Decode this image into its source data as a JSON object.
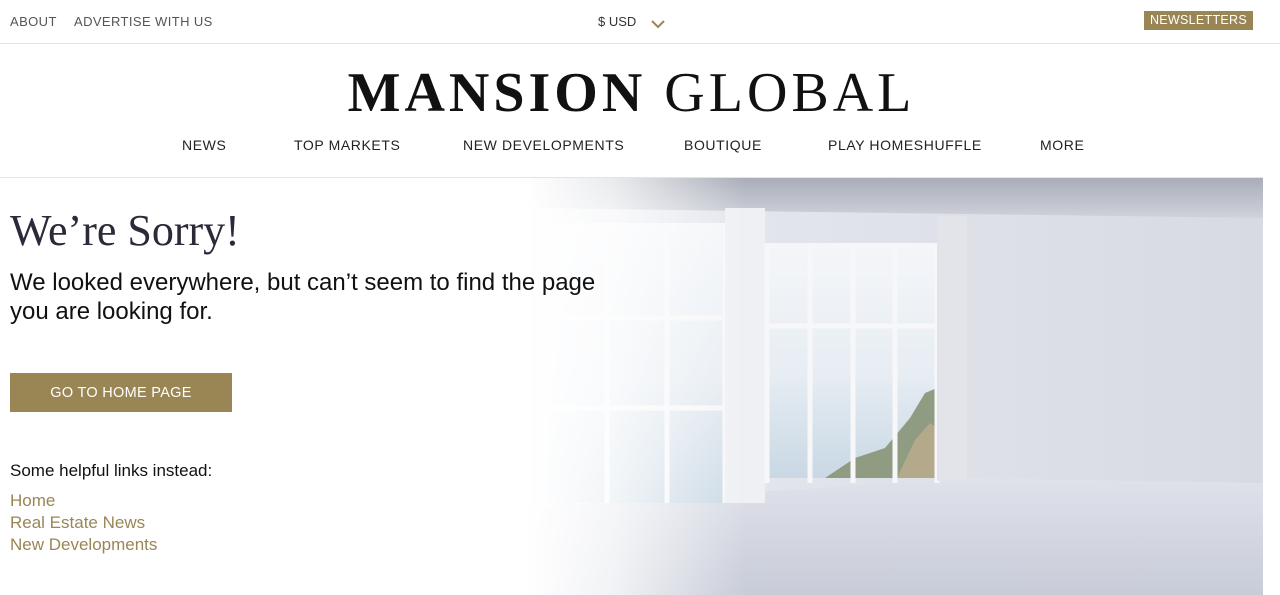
{
  "topbar": {
    "about": "ABOUT",
    "advertise": "ADVERTISE WITH US",
    "currency": "$ USD",
    "newsletters": "NEWSLETTERS"
  },
  "header": {
    "logo_bold": "MANSION",
    "logo_light": "GLOBAL"
  },
  "nav": {
    "items": [
      "NEWS",
      "TOP MARKETS",
      "NEW DEVELOPMENTS",
      "BOUTIQUE",
      "PLAY HOMESHUFFLE",
      "MORE"
    ]
  },
  "error": {
    "title": "We’re Sorry!",
    "message": "We looked everywhere, but can’t seem to find the page you are looking for.",
    "home_button": "GO TO HOME PAGE",
    "helpful_label": "Some helpful links instead:",
    "links": [
      "Home",
      "Real Estate News",
      "New Developments"
    ]
  },
  "colors": {
    "accent": "#9a8654",
    "title": "#2a2a38"
  },
  "icons": {
    "currency_dropdown": "chevron-down-icon"
  }
}
